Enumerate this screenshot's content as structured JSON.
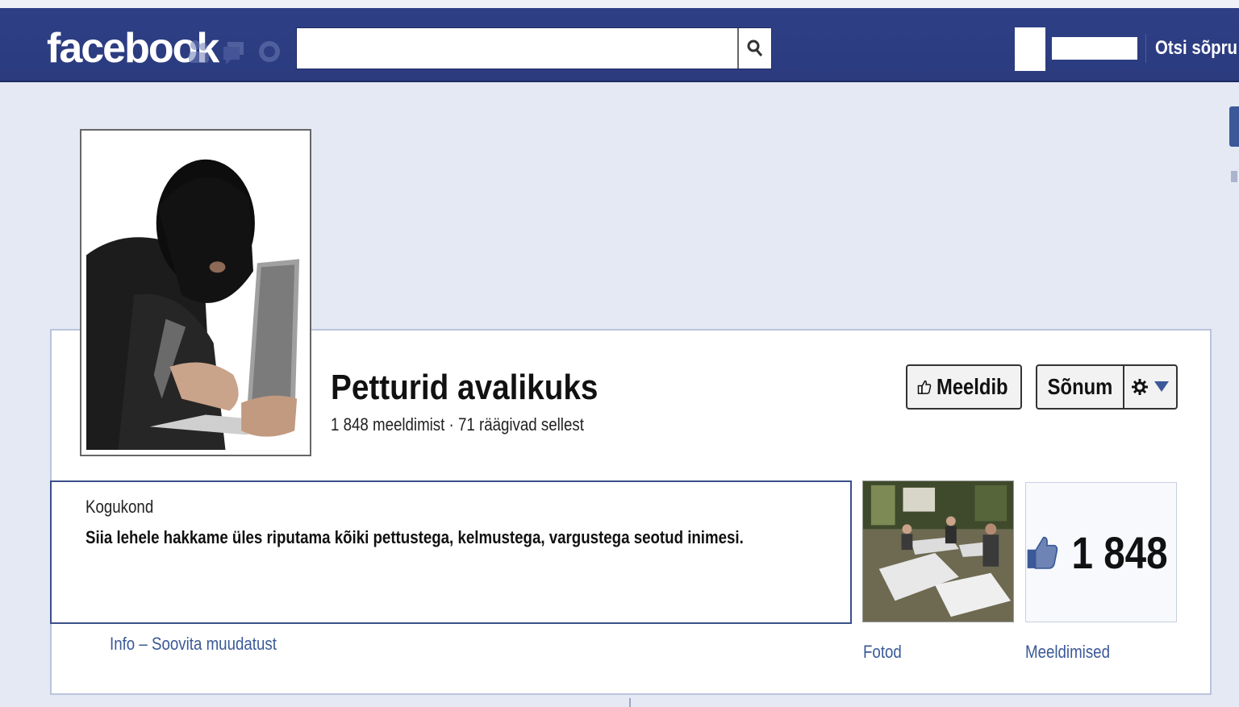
{
  "colors": {
    "nav_bg": "#2f3f86",
    "link": "#3b5998",
    "page_bg": "#e4e9f4"
  },
  "topbar": {
    "logo": "facebook",
    "search": {
      "value": "",
      "placeholder": ""
    },
    "find_friends": "Otsi sõpru",
    "icons": [
      "friend-requests-icon",
      "messages-icon",
      "notifications-icon",
      "search-icon"
    ]
  },
  "profile": {
    "name": "Petturid avalikuks",
    "stats": "1 848 meeldimist · 71 räägivad sellest",
    "like_button": "Meeldib",
    "message_button": "Sõnum"
  },
  "about": {
    "category": "Kogukond",
    "description": "Siia lehele hakkame üles riputama kõiki pettustega, kelmustega, vargustega seotud inimesi.",
    "link_info": "Info",
    "separator": "–",
    "link_suggest": "Soovita muudatust"
  },
  "tiles": {
    "photos_label": "Fotod",
    "likes_count": "1 848",
    "likes_label": "Meeldimised"
  }
}
